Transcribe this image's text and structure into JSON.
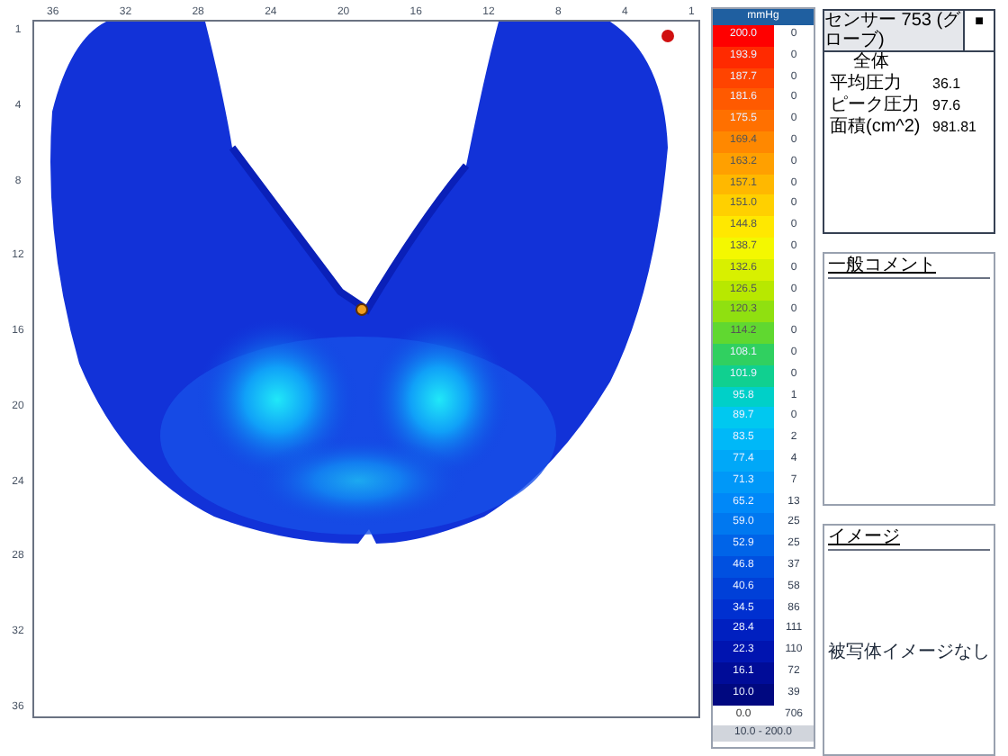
{
  "map": {
    "x_ticks": [
      "36",
      "32",
      "28",
      "24",
      "20",
      "16",
      "12",
      "8",
      "4",
      "1"
    ],
    "y_ticks": [
      "1",
      "4",
      "8",
      "12",
      "16",
      "20",
      "24",
      "28",
      "32",
      "36"
    ]
  },
  "legend": {
    "unit": "mmHg",
    "range": "10.0 - 200.0",
    "rows": [
      {
        "value": "200.0",
        "count": "0",
        "color": "#ff0000"
      },
      {
        "value": "193.9",
        "count": "0",
        "color": "#ff2a00"
      },
      {
        "value": "187.7",
        "count": "0",
        "color": "#ff4400"
      },
      {
        "value": "181.6",
        "count": "0",
        "color": "#ff5a00"
      },
      {
        "value": "175.5",
        "count": "0",
        "color": "#ff7000"
      },
      {
        "value": "169.4",
        "count": "0",
        "color": "#ff8800"
      },
      {
        "value": "163.2",
        "count": "0",
        "color": "#ffa000"
      },
      {
        "value": "157.1",
        "count": "0",
        "color": "#ffb800"
      },
      {
        "value": "151.0",
        "count": "0",
        "color": "#ffd000"
      },
      {
        "value": "144.8",
        "count": "0",
        "color": "#ffe800"
      },
      {
        "value": "138.7",
        "count": "0",
        "color": "#f4f800"
      },
      {
        "value": "132.6",
        "count": "0",
        "color": "#d8f000"
      },
      {
        "value": "126.5",
        "count": "0",
        "color": "#b8e800"
      },
      {
        "value": "120.3",
        "count": "0",
        "color": "#90e010"
      },
      {
        "value": "114.2",
        "count": "0",
        "color": "#60d830"
      },
      {
        "value": "108.1",
        "count": "0",
        "color": "#30d060"
      },
      {
        "value": "101.9",
        "count": "0",
        "color": "#10d090"
      },
      {
        "value": "95.8",
        "count": "1",
        "color": "#00d0c8"
      },
      {
        "value": "89.7",
        "count": "0",
        "color": "#00c8f0"
      },
      {
        "value": "83.5",
        "count": "2",
        "color": "#00b8f8"
      },
      {
        "value": "77.4",
        "count": "4",
        "color": "#00a8f8"
      },
      {
        "value": "71.3",
        "count": "7",
        "color": "#0098f8"
      },
      {
        "value": "65.2",
        "count": "13",
        "color": "#0088f8"
      },
      {
        "value": "59.0",
        "count": "25",
        "color": "#0078f0"
      },
      {
        "value": "52.9",
        "count": "25",
        "color": "#0064e8"
      },
      {
        "value": "46.8",
        "count": "37",
        "color": "#0050e0"
      },
      {
        "value": "40.6",
        "count": "58",
        "color": "#0040d8"
      },
      {
        "value": "34.5",
        "count": "86",
        "color": "#0030d0"
      },
      {
        "value": "28.4",
        "count": "111",
        "color": "#0020c0"
      },
      {
        "value": "22.3",
        "count": "110",
        "color": "#0014b0"
      },
      {
        "value": "16.1",
        "count": "72",
        "color": "#000c98"
      },
      {
        "value": "10.0",
        "count": "39",
        "color": "#000880"
      },
      {
        "value": "0.0",
        "count": "706",
        "color": "#ffffff"
      }
    ]
  },
  "stats": {
    "header": "センサー 753 (グローブ)",
    "header_value": "■",
    "group": "全体",
    "rows": [
      {
        "label": "平均圧力",
        "value": "36.1"
      },
      {
        "label": "ピーク圧力",
        "value": "97.6"
      },
      {
        "label": "面積(cm^2)",
        "value": "981.81"
      }
    ]
  },
  "comment": {
    "title": "一般コメント"
  },
  "image": {
    "title": "イメージ",
    "empty_text": "被写体イメージなし"
  }
}
